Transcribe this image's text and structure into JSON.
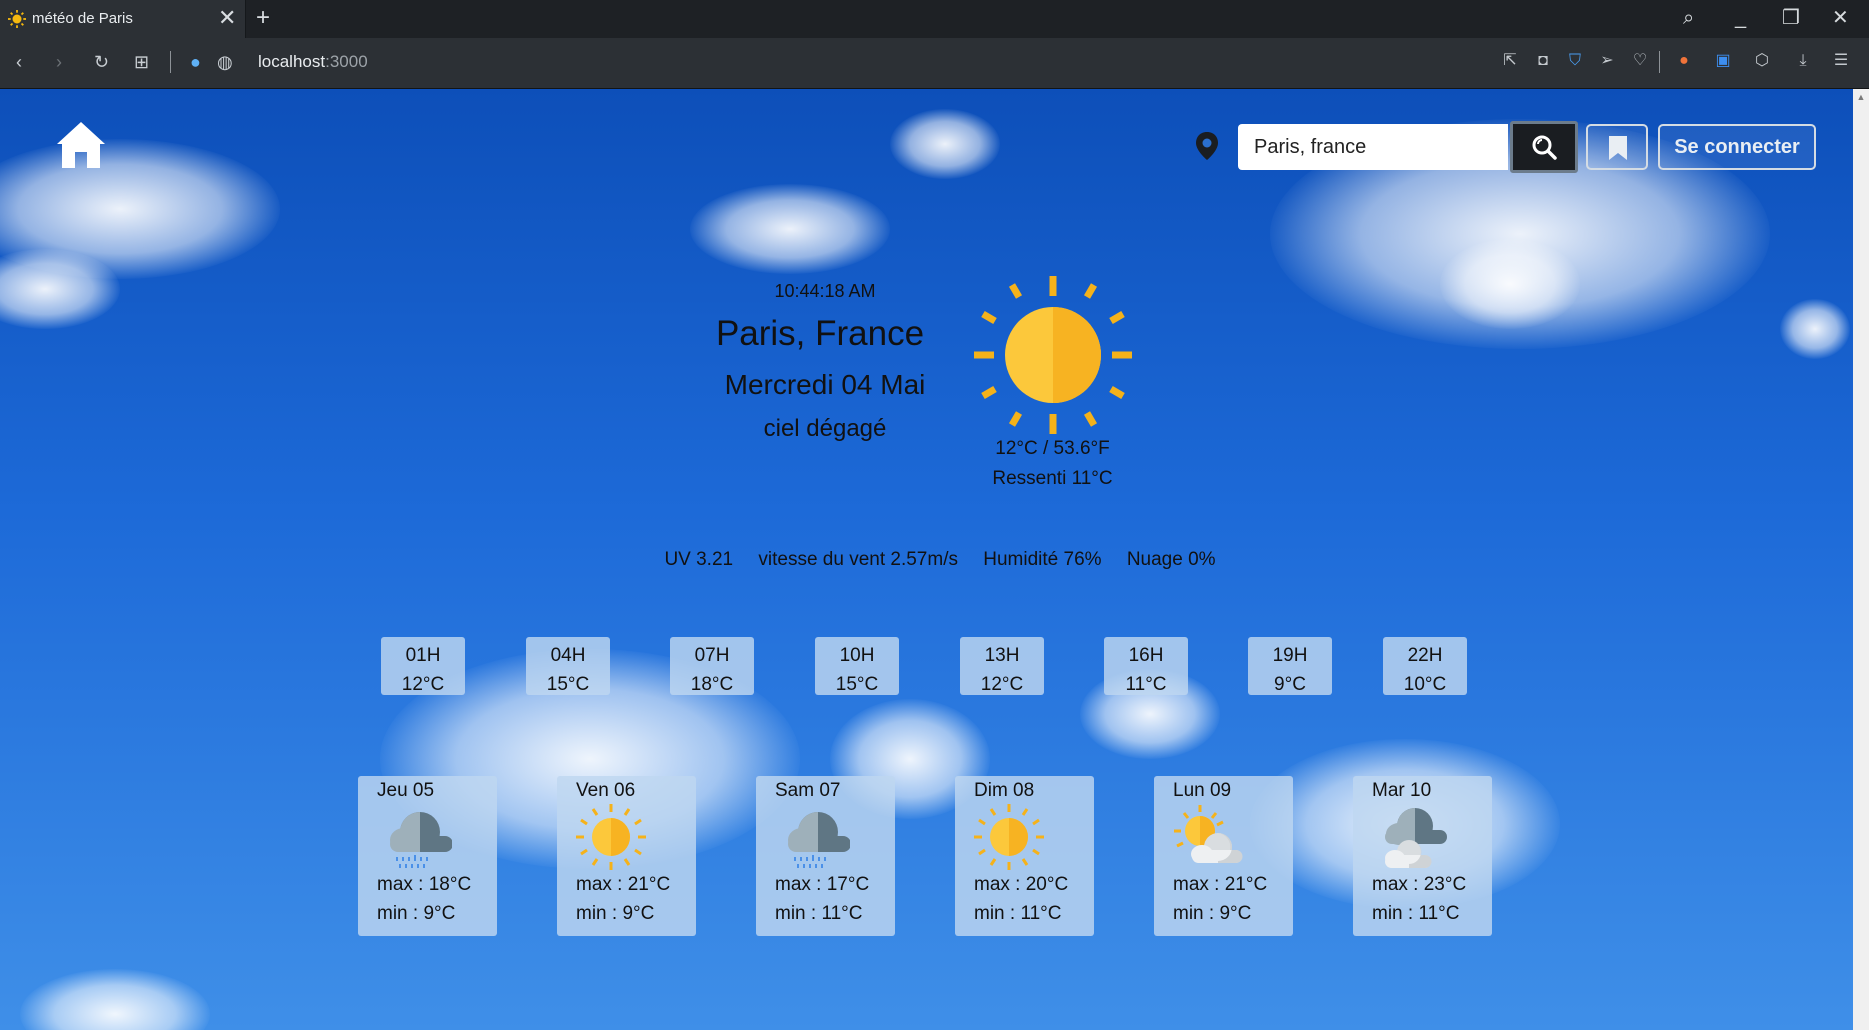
{
  "browser": {
    "tab_title": "météo de Paris",
    "url_host": "localhost",
    "url_port": ":3000"
  },
  "header": {
    "search_value": "Paris, france",
    "login_label": "Se connecter"
  },
  "current": {
    "time": "10:44:18 AM",
    "city": "Paris, France",
    "date": "Mercredi 04 Mai",
    "description": "ciel dégagé",
    "icon": "sun-icon",
    "temperature": "12°C / 53.6°F",
    "feels_like": "Ressenti 11°C"
  },
  "stats": {
    "uv": "UV 3.21",
    "wind": "vitesse du vent 2.57m/s",
    "humidity": "Humidité 76%",
    "clouds": "Nuage 0%"
  },
  "hourly": [
    {
      "hour": "01H",
      "temp": "12°C"
    },
    {
      "hour": "04H",
      "temp": "15°C"
    },
    {
      "hour": "07H",
      "temp": "18°C"
    },
    {
      "hour": "10H",
      "temp": "15°C"
    },
    {
      "hour": "13H",
      "temp": "12°C"
    },
    {
      "hour": "16H",
      "temp": "11°C"
    },
    {
      "hour": "19H",
      "temp": "9°C"
    },
    {
      "hour": "22H",
      "temp": "10°C"
    }
  ],
  "daily": [
    {
      "day": "Jeu 05",
      "icon": "rain-cloud-icon",
      "max": "max : 18°C",
      "min": "min : 9°C"
    },
    {
      "day": "Ven 06",
      "icon": "sun-icon",
      "max": "max : 21°C",
      "min": "min : 9°C"
    },
    {
      "day": "Sam 07",
      "icon": "rain-cloud-icon",
      "max": "max : 17°C",
      "min": "min : 11°C"
    },
    {
      "day": "Dim 08",
      "icon": "sun-icon",
      "max": "max : 20°C",
      "min": "min : 11°C"
    },
    {
      "day": "Lun 09",
      "icon": "sun-cloud-icon",
      "max": "max : 21°C",
      "min": "min : 9°C"
    },
    {
      "day": "Mar 10",
      "icon": "clouds-icon",
      "max": "max : 23°C",
      "min": "min : 11°C"
    }
  ]
}
